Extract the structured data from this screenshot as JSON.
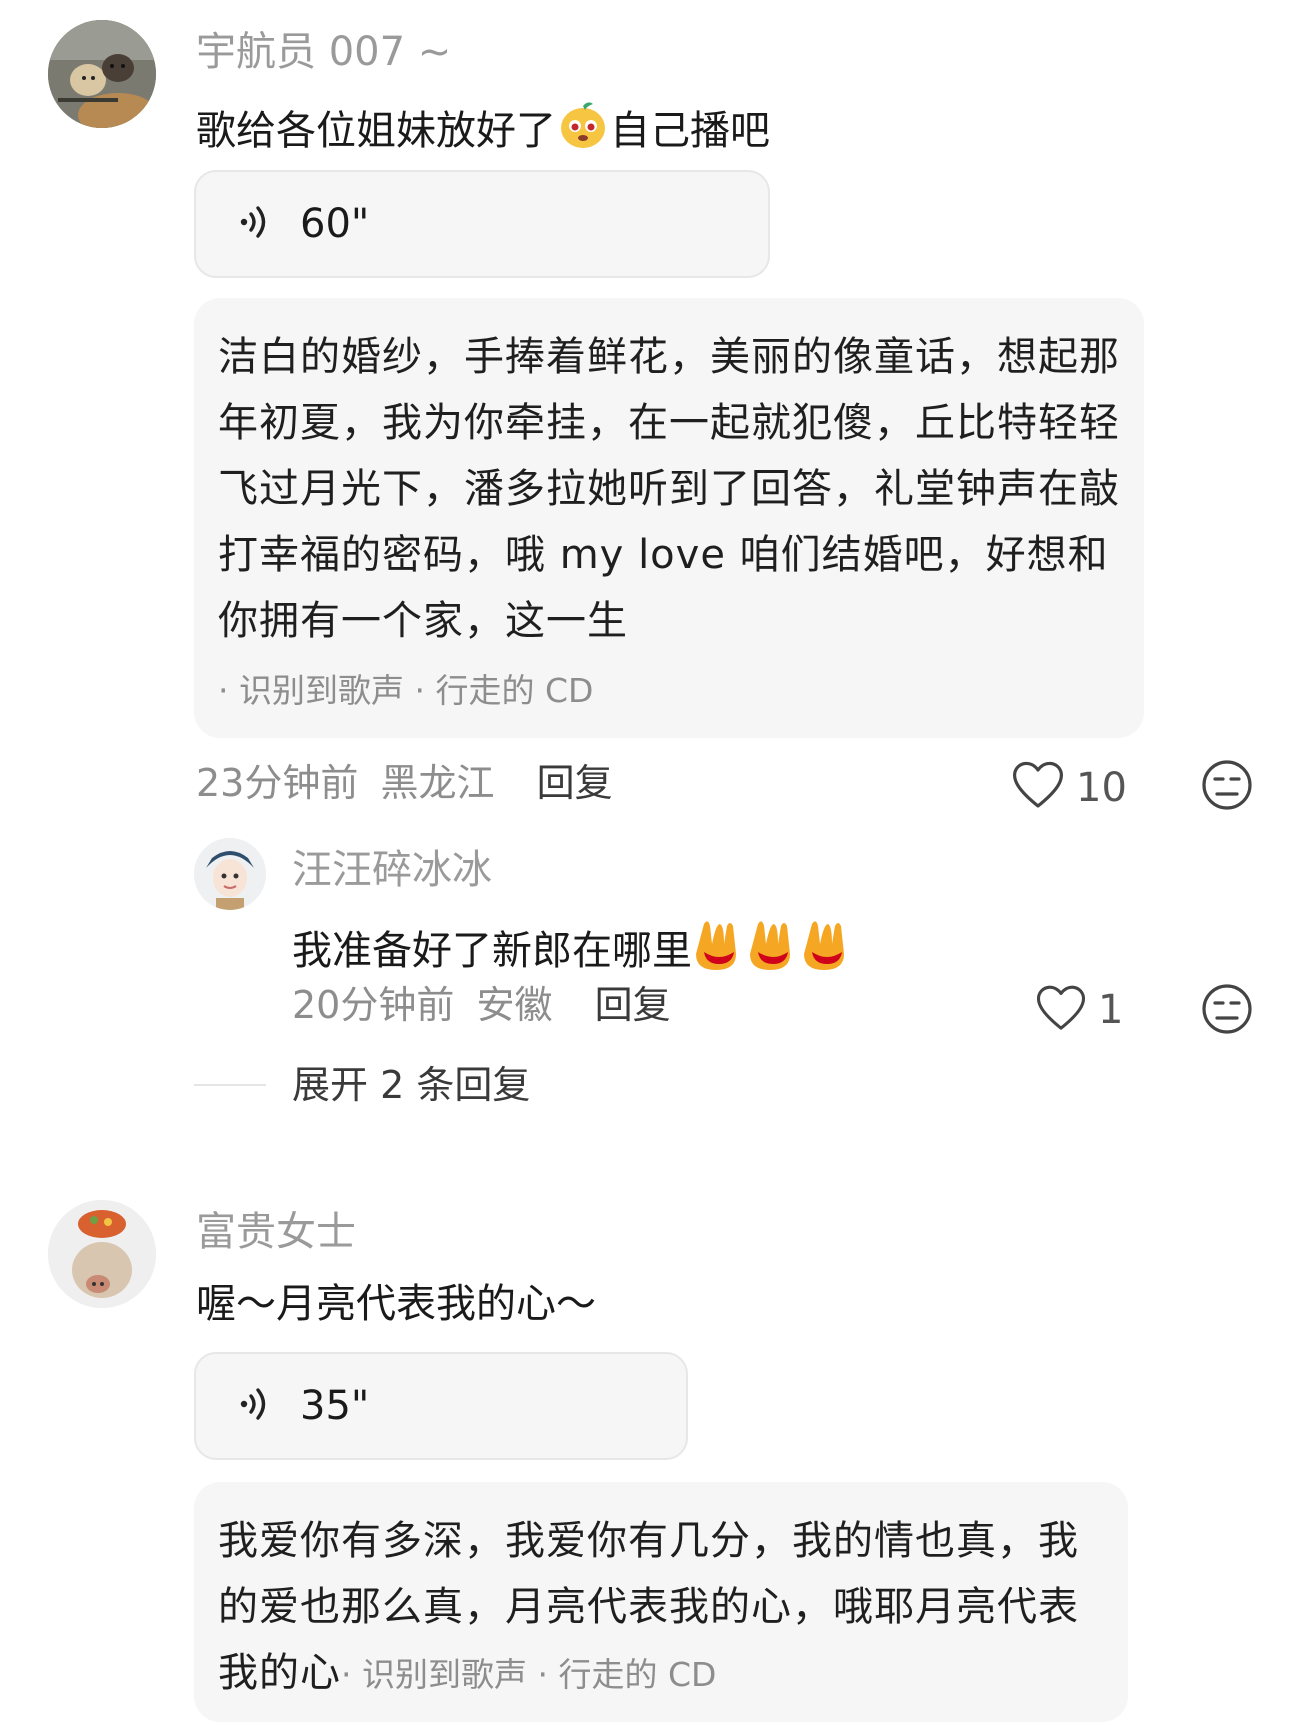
{
  "comments": [
    {
      "username": "宇航员 007 ~",
      "text_before": "歌给各位姐妹放好了",
      "text_after": "自己播吧",
      "emoji": "mango-face-emoji",
      "voice_duration": "60\"",
      "lyrics": "洁白的婚纱，手捧着鲜花，美丽的像童话，想起那年初夏，我为你牵挂，在一起就犯傻，丘比特轻轻飞过月光下，潘多拉她听到了回答，礼堂钟声在敲打幸福的密码，哦 my love 咱们结婚吧，好想和你拥有一个家，这一生",
      "source": "· 识别到歌声 · 行走的 CD",
      "time": "23分钟前",
      "location": "黑龙江",
      "reply_label": "回复",
      "likes": "10",
      "replies": [
        {
          "username": "汪汪碎冰冰",
          "text": "我准备好了新郎在哪里",
          "emoji_count": 3,
          "time": "20分钟前",
          "location": "安徽",
          "reply_label": "回复",
          "likes": "1"
        }
      ],
      "expand_label": "展开 2 条回复"
    },
    {
      "username": "富贵女士",
      "text": "喔～月亮代表我的心～",
      "voice_duration": "35\"",
      "lyrics": "我爱你有多深，我爱你有几分，我的情也真，我的爱也那么真，月亮代表我的心，哦耶月亮代表我的心",
      "source": "· 识别到歌声 · 行走的 CD"
    }
  ],
  "colors": {
    "name_gray": "#9a9a9a",
    "meta_gray": "#8d8d8d",
    "card_bg": "#f6f6f7",
    "voice_border": "#e7e7ea"
  }
}
